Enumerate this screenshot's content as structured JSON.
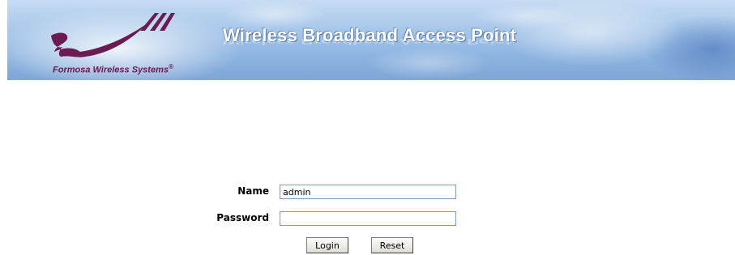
{
  "header": {
    "company_name": "Formosa Wireless Systems",
    "registered_mark": "®",
    "title": "Wireless Broadband Access Point",
    "logo_icon": "swoosh-wireless-logo"
  },
  "login": {
    "name_label": "Name",
    "name_value": "admin",
    "password_label": "Password",
    "password_value": "",
    "login_button": "Login",
    "reset_button": "Reset"
  }
}
